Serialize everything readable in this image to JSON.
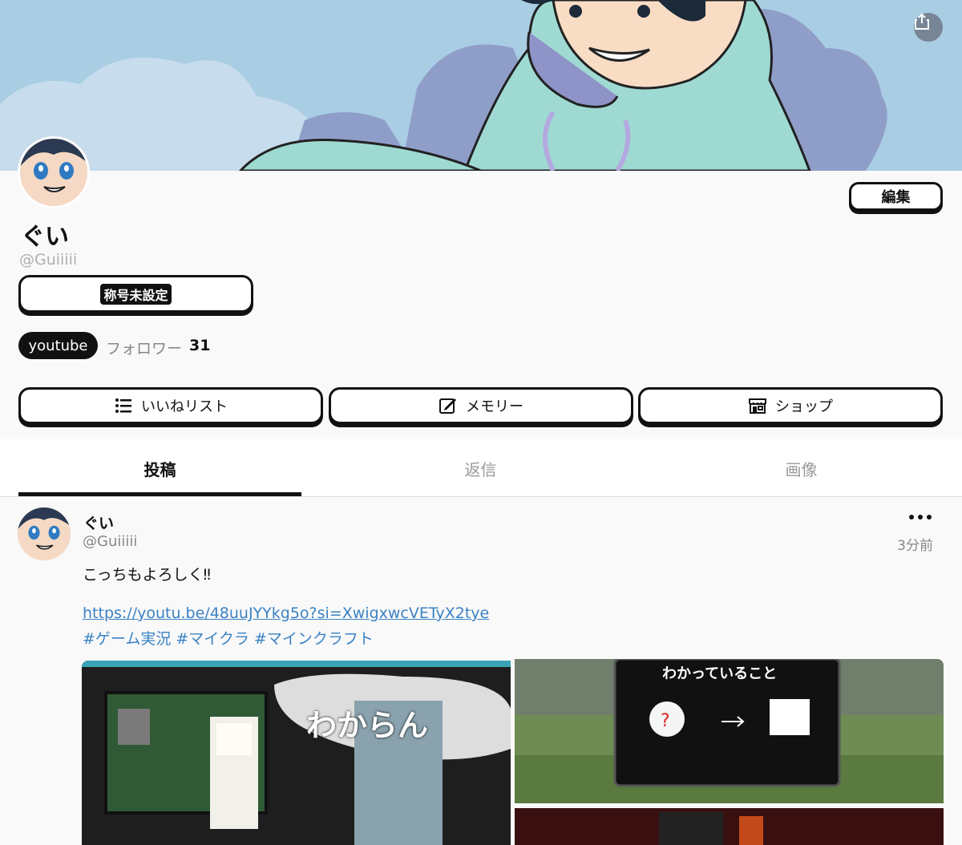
{
  "profile": {
    "name": "ぐい",
    "handle": "@Guiiiii",
    "title_badge": "称号未設定",
    "edit_label": "編集",
    "link_tag": "youtube",
    "followers_label": "フォロワー",
    "followers_count": "31"
  },
  "actions": {
    "likes_list": "いいねリスト",
    "memory": "メモリー",
    "shop": "ショップ"
  },
  "tabs": {
    "posts": "投稿",
    "replies": "返信",
    "images": "画像"
  },
  "post": {
    "name": "ぐい",
    "handle": "@Guiiiii",
    "time": "3分前",
    "text": "こっちもよろしく‼︎",
    "link": "https://youtu.be/48uuJYYkg5o?si=XwigxwcVETyX2tye",
    "tags": [
      "#ゲーム実況",
      "#マイクラ",
      "#マインクラフト"
    ],
    "media_caption_1": "わからん",
    "media_caption_2": "わかっていること"
  },
  "icons": [
    "share-icon",
    "list-icon",
    "edit-icon",
    "shop-icon",
    "more-icon"
  ]
}
